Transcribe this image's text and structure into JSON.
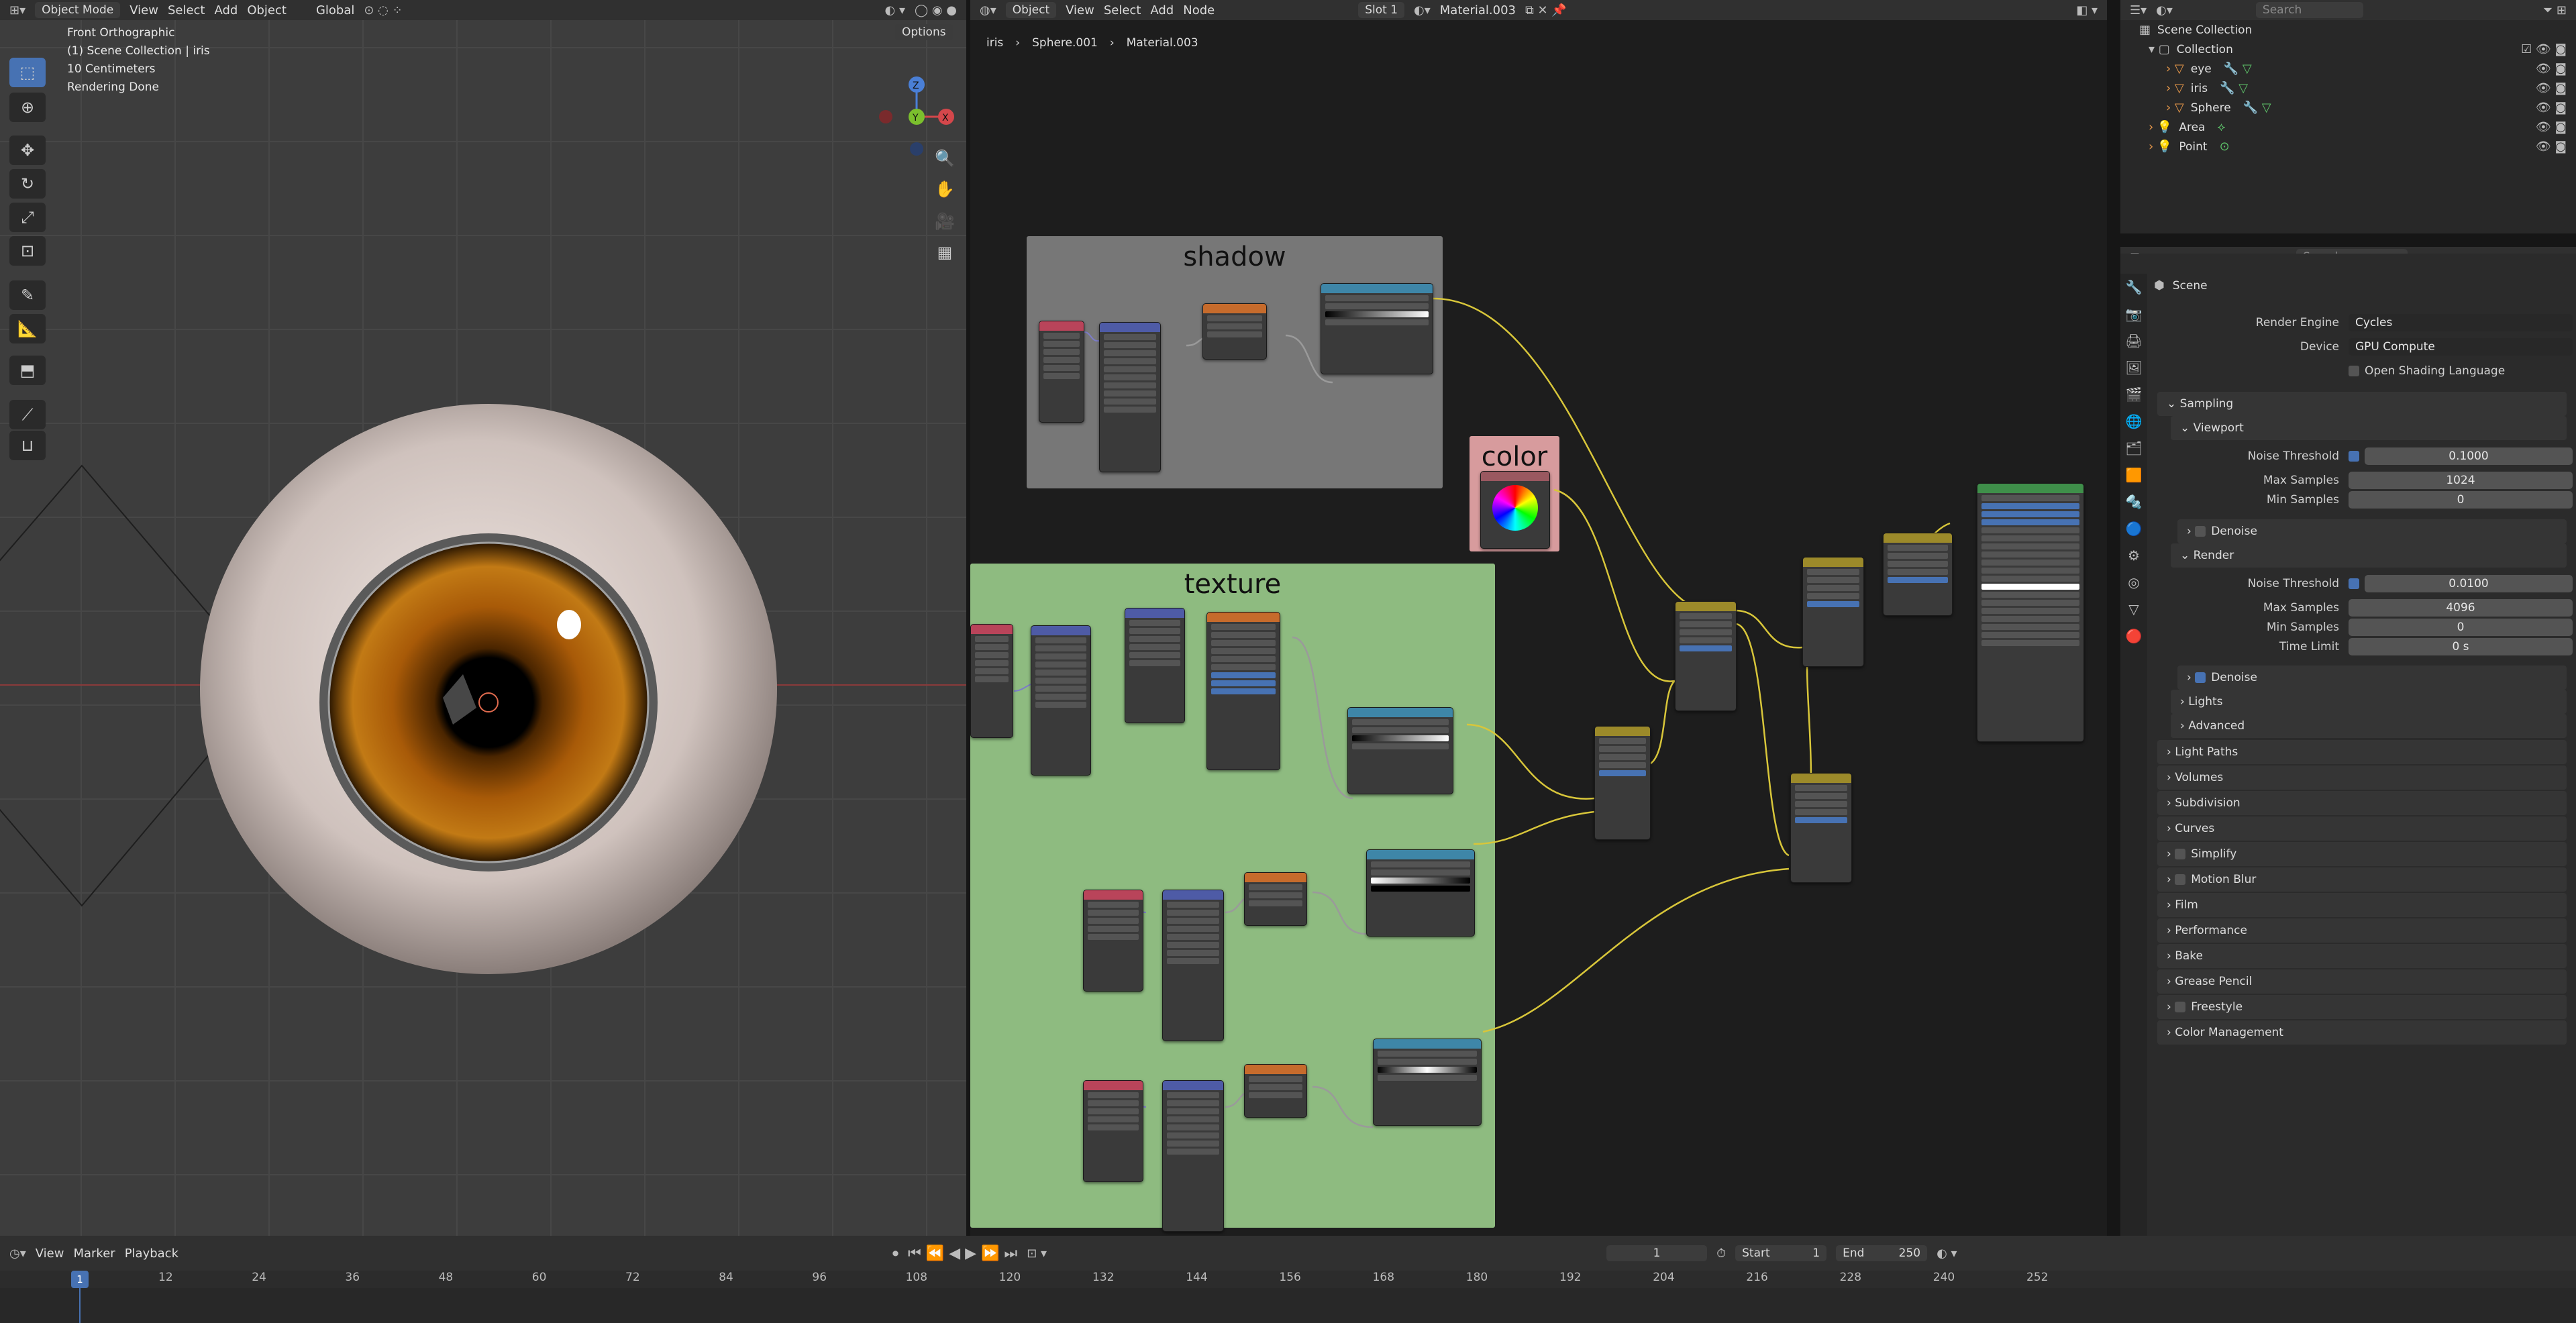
{
  "topbar": {
    "mode": "Object Mode",
    "menus": [
      "View",
      "Select",
      "Add",
      "Object"
    ],
    "transform": "Global",
    "options": "Options"
  },
  "viewport": {
    "view_name": "Front Orthographic",
    "collection": "(1) Scene Collection | iris",
    "scale": "10 Centimeters",
    "status": "Rendering Done",
    "gizmo": {
      "z": "Z",
      "y": "Y",
      "x": "X"
    }
  },
  "node_editor": {
    "mode": "Object",
    "menus": [
      "View",
      "Select",
      "Add",
      "Node"
    ],
    "slot": "Slot 1",
    "material": "Material.003",
    "breadcrumb": [
      "iris",
      "Sphere.001",
      "Material.003"
    ],
    "frames": {
      "shadow": "shadow",
      "color": "color",
      "texture": "texture"
    },
    "frame_colors": {
      "shadow": "#777777",
      "color": "#d79b9d",
      "texture": "#8ebb80"
    }
  },
  "outliner": {
    "title": "Scene Collection",
    "items": [
      "Collection",
      "eye",
      "iris",
      "Sphere",
      "Area",
      "Point"
    ],
    "search_placeholder": "Search"
  },
  "properties": {
    "search_placeholder": "Search",
    "scene_label": "Scene",
    "render_engine": {
      "label": "Render Engine",
      "value": "Cycles"
    },
    "device": {
      "label": "Device",
      "value": "GPU Compute"
    },
    "osl": "Open Shading Language",
    "sampling": "Sampling",
    "viewport": "Viewport",
    "vp_noise": {
      "label": "Noise Threshold",
      "value": "0.1000"
    },
    "vp_max": {
      "label": "Max Samples",
      "value": "1024"
    },
    "vp_min": {
      "label": "Min Samples",
      "value": "0"
    },
    "denoise": "Denoise",
    "render": "Render",
    "r_noise": {
      "label": "Noise Threshold",
      "value": "0.0100"
    },
    "r_max": {
      "label": "Max Samples",
      "value": "4096"
    },
    "r_min": {
      "label": "Min Samples",
      "value": "0"
    },
    "r_time": {
      "label": "Time Limit",
      "value": "0 s"
    },
    "r_denoise": "Denoise",
    "lights": "Lights",
    "advanced": "Advanced",
    "sections": [
      "Light Paths",
      "Volumes",
      "Subdivision",
      "Curves",
      "Simplify",
      "Motion Blur",
      "Film",
      "Performance",
      "Bake",
      "Grease Pencil",
      "Freestyle",
      "Color Management"
    ]
  },
  "timeline": {
    "menus": [
      "View",
      "Marker",
      "Playback"
    ],
    "current_frame": "1",
    "start_label": "Start",
    "start": "1",
    "end_label": "End",
    "end": "250",
    "ticks": [
      "1",
      "12",
      "24",
      "36",
      "48",
      "60",
      "72",
      "84",
      "96",
      "108",
      "120",
      "132",
      "144",
      "156",
      "168",
      "180",
      "192",
      "204",
      "216",
      "228",
      "240",
      "252"
    ]
  }
}
